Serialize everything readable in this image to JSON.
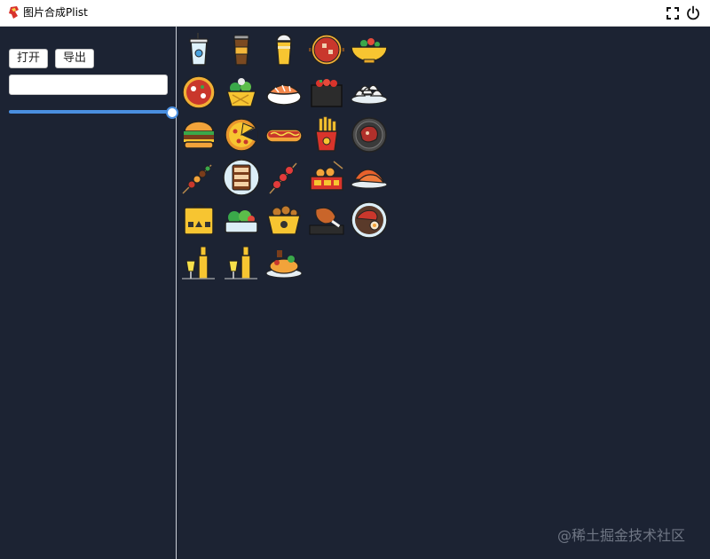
{
  "window": {
    "title": "图片合成Plist"
  },
  "toolbar": {
    "open_label": "打开",
    "export_label": "导出"
  },
  "name_input": {
    "value": "",
    "placeholder": ""
  },
  "scale_slider": {
    "value_percent": 100
  },
  "icons": [
    {
      "name": "iced-drink-cup-icon",
      "row": 0,
      "col": 0
    },
    {
      "name": "coffee-cup-icon",
      "row": 0,
      "col": 1
    },
    {
      "name": "bubble-tea-icon",
      "row": 0,
      "col": 2
    },
    {
      "name": "hotpot-icon",
      "row": 0,
      "col": 3
    },
    {
      "name": "salad-bowl-icon",
      "row": 0,
      "col": 4
    },
    {
      "name": "pizza-pan-icon",
      "row": 1,
      "col": 0
    },
    {
      "name": "vegetable-basket-icon",
      "row": 1,
      "col": 1
    },
    {
      "name": "sushi-icon",
      "row": 1,
      "col": 2
    },
    {
      "name": "bento-box-icon",
      "row": 1,
      "col": 3
    },
    {
      "name": "dumplings-plate-icon",
      "row": 1,
      "col": 4
    },
    {
      "name": "burger-icon",
      "row": 2,
      "col": 0
    },
    {
      "name": "pizza-icon",
      "row": 2,
      "col": 1
    },
    {
      "name": "hotdog-icon",
      "row": 2,
      "col": 2
    },
    {
      "name": "french-fries-icon",
      "row": 2,
      "col": 3
    },
    {
      "name": "steak-pan-icon",
      "row": 2,
      "col": 4
    },
    {
      "name": "skewers-icon",
      "row": 3,
      "col": 0
    },
    {
      "name": "sushi-roll-plate-icon",
      "row": 3,
      "col": 1
    },
    {
      "name": "tanghulu-icon",
      "row": 3,
      "col": 2
    },
    {
      "name": "takoyaki-tray-icon",
      "row": 3,
      "col": 3
    },
    {
      "name": "shrimp-plate-icon",
      "row": 3,
      "col": 4
    },
    {
      "name": "takeout-bag-icon",
      "row": 4,
      "col": 0
    },
    {
      "name": "salad-box-icon",
      "row": 4,
      "col": 1
    },
    {
      "name": "fried-chicken-basket-icon",
      "row": 4,
      "col": 2
    },
    {
      "name": "roast-chicken-leg-icon",
      "row": 4,
      "col": 3
    },
    {
      "name": "ramen-bowl-icon",
      "row": 4,
      "col": 4
    },
    {
      "name": "beer-bottle-icon",
      "row": 5,
      "col": 0
    },
    {
      "name": "beer-glass-bottle-icon",
      "row": 5,
      "col": 1
    },
    {
      "name": "dinner-platter-icon",
      "row": 5,
      "col": 2
    }
  ],
  "watermark": "@稀土掘金技术社区"
}
